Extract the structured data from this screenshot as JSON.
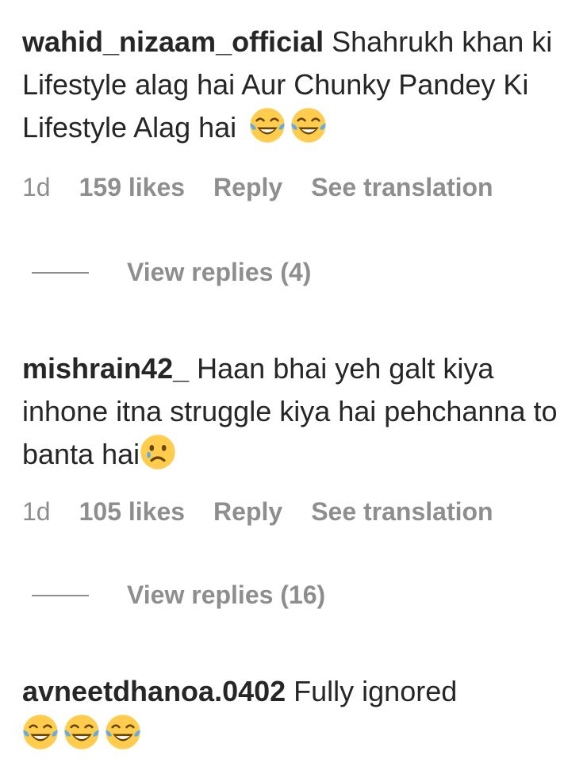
{
  "comments": [
    {
      "username": "wahid_nizaam_official",
      "text": "Shahrukh khan ki Lifestyle alag hai Aur Chunky Pandey Ki Lifestyle Alag hai",
      "emojis": [
        "face-with-tears-of-joy-icon",
        "face-with-tears-of-joy-icon"
      ],
      "time": "1d",
      "likes": "159 likes",
      "reply_label": "Reply",
      "translate_label": "See translation",
      "view_replies": "View replies (4)"
    },
    {
      "username": "mishrain42_",
      "text": "Haan bhai yeh galt kiya inhone itna struggle kiya hai pehchanna to banta hai",
      "emojis": [
        "sad-face-icon"
      ],
      "time": "1d",
      "likes": "105 likes",
      "reply_label": "Reply",
      "translate_label": "See translation",
      "view_replies": "View replies (16)"
    },
    {
      "username": "avneetdhanoa.0402",
      "text": "Fully ignored",
      "emojis": [
        "face-with-tears-of-joy-icon",
        "face-with-tears-of-joy-icon",
        "face-with-tears-of-joy-icon"
      ]
    }
  ],
  "colors": {
    "text": "#262626",
    "muted": "#8e8e8e",
    "emoji_yellow": "#ffcc4d",
    "emoji_blue": "#5dadec"
  }
}
